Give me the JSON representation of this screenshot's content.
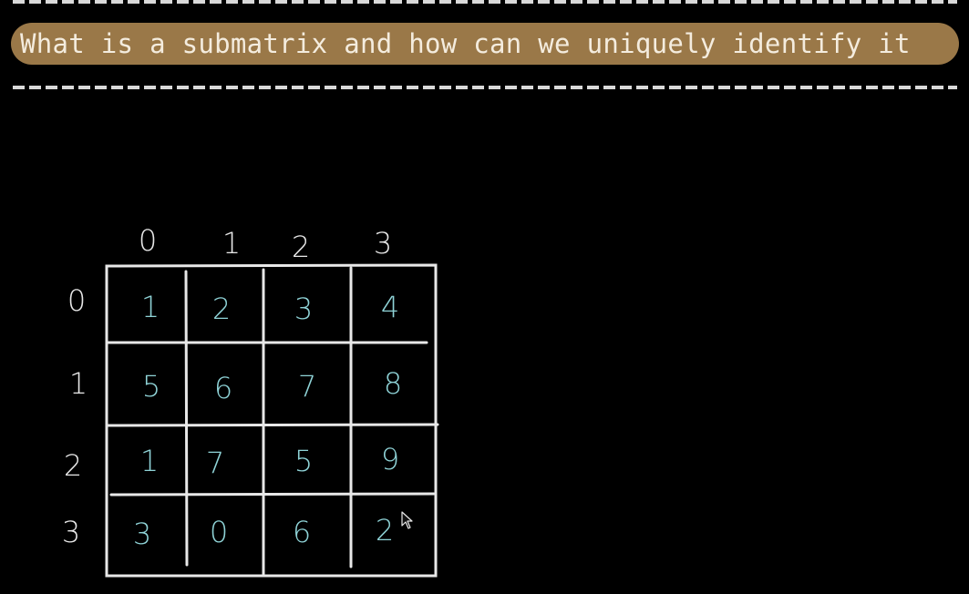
{
  "title": "What is a submatrix and how can we uniquely identify it",
  "column_indices": [
    "0",
    "1",
    "2",
    "3"
  ],
  "row_indices": [
    "0",
    "1",
    "2",
    "3"
  ],
  "matrix": [
    [
      "1",
      "2",
      "3",
      "4"
    ],
    [
      "5",
      "6",
      "7",
      "8"
    ],
    [
      "1",
      "7",
      "5",
      "9"
    ],
    [
      "3",
      "0",
      "6",
      "2"
    ]
  ],
  "colors": {
    "background": "#000000",
    "title_pill": "#9a7848",
    "title_text": "#f4ecde",
    "grid_lines": "#e8e8e8",
    "index_ink": "#e8e8e8",
    "cell_ink": "#8fd3d7"
  },
  "icons": {
    "cursor": "mouse-pointer-icon"
  }
}
